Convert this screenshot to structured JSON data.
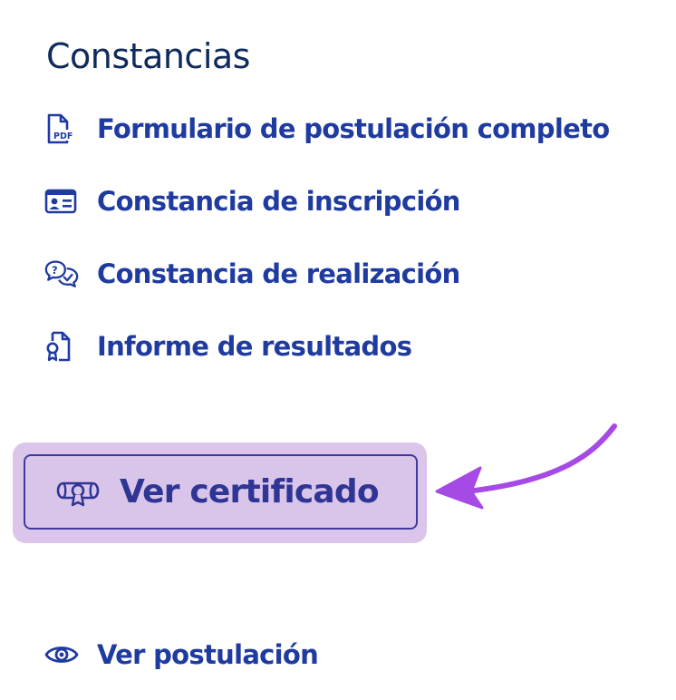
{
  "section": {
    "title": "Constancias"
  },
  "links": [
    {
      "label": "Formulario de postulación completo",
      "icon": "pdf-file-icon"
    },
    {
      "label": "Constancia de inscripción",
      "icon": "id-card-icon"
    },
    {
      "label": "Constancia de realización",
      "icon": "chat-check-icon"
    },
    {
      "label": "Informe de resultados",
      "icon": "file-award-icon"
    }
  ],
  "certificate_button": {
    "label": "Ver certificado",
    "icon": "diploma-icon"
  },
  "view_link": {
    "label": "Ver postulación",
    "icon": "eye-icon"
  },
  "colors": {
    "link": "#1f3ba0",
    "heading": "#0f2a5c",
    "highlight": "#dcc5ea",
    "button_border": "#3f3a9e",
    "arrow": "#a64ae6"
  }
}
